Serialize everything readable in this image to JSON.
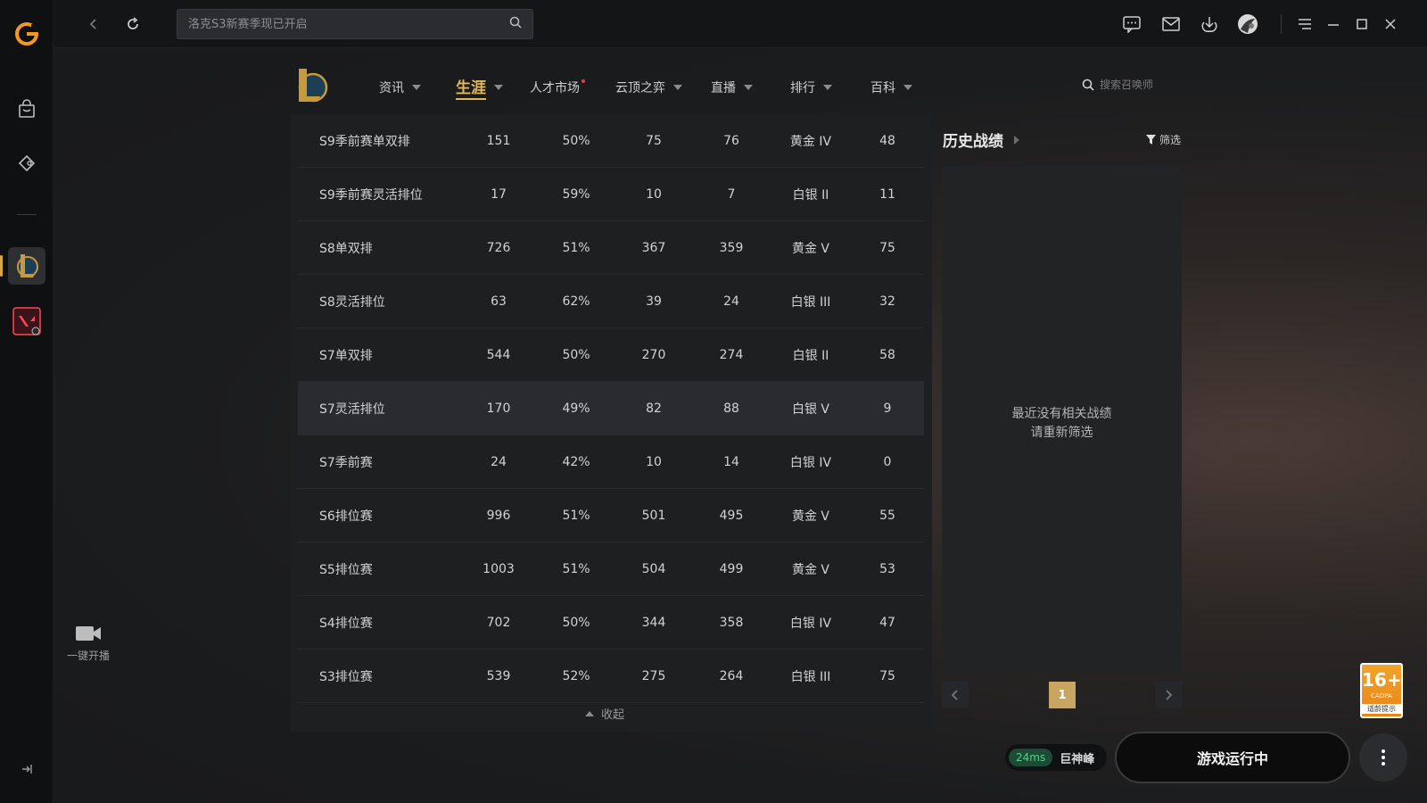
{
  "topbar": {
    "search_placeholder": "洛克S3新赛季现已开启"
  },
  "left": {
    "live_label": "一键开播"
  },
  "nav": {
    "items": [
      {
        "label": "资讯"
      },
      {
        "label": "生涯",
        "active": true
      },
      {
        "label": "人才市场",
        "badge": "red-dot"
      },
      {
        "label": "云顶之弈"
      },
      {
        "label": "直播"
      },
      {
        "label": "排行"
      },
      {
        "label": "百科"
      }
    ],
    "search_placeholder": "搜索召唤师"
  },
  "table": {
    "rows": [
      {
        "season": "S9季前赛单双排",
        "games": "151",
        "winrate": "50%",
        "wins": "75",
        "losses": "76",
        "rank": "黄金 IV",
        "points": "48"
      },
      {
        "season": "S9季前赛灵活排位",
        "games": "17",
        "winrate": "59%",
        "wins": "10",
        "losses": "7",
        "rank": "白银 II",
        "points": "11"
      },
      {
        "season": "S8单双排",
        "games": "726",
        "winrate": "51%",
        "wins": "367",
        "losses": "359",
        "rank": "黄金 V",
        "points": "75"
      },
      {
        "season": "S8灵活排位",
        "games": "63",
        "winrate": "62%",
        "wins": "39",
        "losses": "24",
        "rank": "白银 III",
        "points": "32"
      },
      {
        "season": "S7单双排",
        "games": "544",
        "winrate": "50%",
        "wins": "270",
        "losses": "274",
        "rank": "白银 II",
        "points": "58"
      },
      {
        "season": "S7灵活排位",
        "games": "170",
        "winrate": "49%",
        "wins": "82",
        "losses": "88",
        "rank": "白银 V",
        "points": "9"
      },
      {
        "season": "S7季前赛",
        "games": "24",
        "winrate": "42%",
        "wins": "10",
        "losses": "14",
        "rank": "白银 IV",
        "points": "0"
      },
      {
        "season": "S6排位赛",
        "games": "996",
        "winrate": "51%",
        "wins": "501",
        "losses": "495",
        "rank": "黄金 V",
        "points": "55"
      },
      {
        "season": "S5排位赛",
        "games": "1003",
        "winrate": "51%",
        "wins": "504",
        "losses": "499",
        "rank": "黄金 V",
        "points": "53"
      },
      {
        "season": "S4排位赛",
        "games": "702",
        "winrate": "50%",
        "wins": "344",
        "losses": "358",
        "rank": "白银 IV",
        "points": "47"
      },
      {
        "season": "S3排位赛",
        "games": "539",
        "winrate": "52%",
        "wins": "275",
        "losses": "264",
        "rank": "白银 III",
        "points": "75"
      }
    ],
    "collapse_label": "收起"
  },
  "history": {
    "title": "历史战绩",
    "filter_label": "筛选",
    "empty_line1": "最近没有相关战绩",
    "empty_line2": "请重新筛选",
    "current_page": "1"
  },
  "bottom": {
    "ping": "24ms",
    "server": "巨神峰",
    "launch_label": "游戏运行中",
    "age_rating": "16+",
    "age_small": "CADPA",
    "age_hint": "适龄提示"
  },
  "colors": {
    "accent": "#e5b65a",
    "page_active": "#c8a662",
    "ping_green": "#4fd28a",
    "age_orange": "#f4a329"
  }
}
